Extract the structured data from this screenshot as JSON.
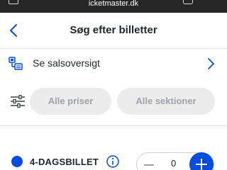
{
  "browser": {
    "url": "icketmaster.dk"
  },
  "header": {
    "title": "Søg efter billetter"
  },
  "sales_overview": {
    "label": "Se salsoversigt"
  },
  "filters": {
    "price_label": "Alle priser",
    "section_label": "Alle sektioner"
  },
  "ticket": {
    "name": "4-DAGSBILLET",
    "quantity": "0",
    "color": "#024DDF"
  },
  "colors": {
    "accent": "#024DDF",
    "pill_bg": "#ECECEC",
    "pill_text": "#9EA2A6"
  }
}
